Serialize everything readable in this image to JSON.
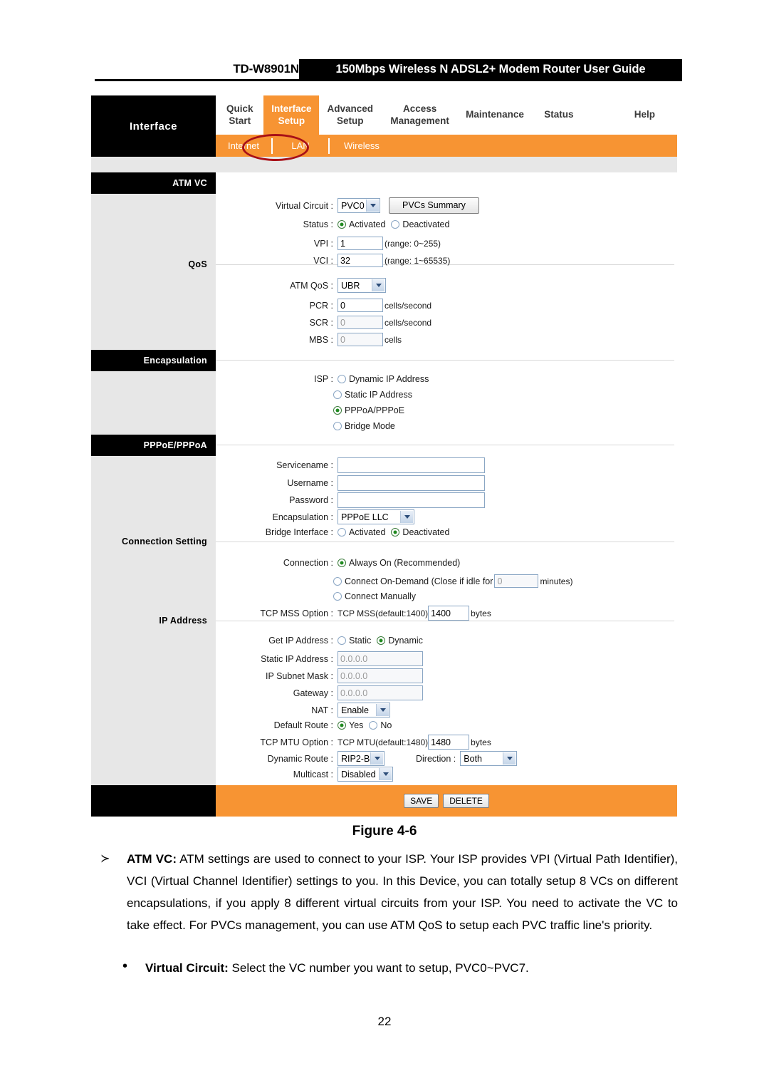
{
  "doc_header": {
    "model": "TD-W8901N",
    "title": "150Mbps Wireless N ADSL2+ Modem Router User Guide"
  },
  "router_ui": {
    "brand_label": "Interface",
    "tabs": [
      {
        "id": "quick-start",
        "line1": "Quick",
        "line2": "Start",
        "active": false
      },
      {
        "id": "interface-setup",
        "line1": "Interface",
        "line2": "Setup",
        "active": true
      },
      {
        "id": "advanced-setup",
        "line1": "Advanced",
        "line2": "Setup",
        "active": false
      },
      {
        "id": "access-management",
        "line1": "Access",
        "line2": "Management",
        "active": false
      },
      {
        "id": "maintenance",
        "line1": "Maintenance",
        "line2": "",
        "active": false
      },
      {
        "id": "status",
        "line1": "Status",
        "line2": "",
        "active": false
      },
      {
        "id": "help",
        "line1": "Help",
        "line2": "",
        "active": false
      }
    ],
    "subtabs": [
      {
        "id": "internet",
        "label": "Internet",
        "active": true
      },
      {
        "id": "lan",
        "label": "LAN",
        "active": false
      },
      {
        "id": "wireless",
        "label": "Wireless",
        "active": false
      }
    ],
    "section_headers": {
      "atm_vc": "ATM VC",
      "qos": "QoS",
      "encapsulation": "Encapsulation",
      "pppoe_pppoa": "PPPoE/PPPoA",
      "connection_setting": "Connection Setting",
      "ip_address": "IP Address"
    },
    "atm_vc": {
      "virtual_circuit_label": "Virtual Circuit :",
      "virtual_circuit_value": "PVC0",
      "pvcs_summary_button": "PVCs Summary",
      "status_label": "Status :",
      "status_activated": "Activated",
      "status_deactivated": "Deactivated",
      "status_selected": "Activated",
      "vpi_label": "VPI :",
      "vpi_value": "1",
      "vpi_hint": "(range: 0~255)",
      "vci_label": "VCI :",
      "vci_value": "32",
      "vci_hint": "(range: 1~65535)"
    },
    "qos": {
      "atm_qos_label": "ATM QoS :",
      "atm_qos_value": "UBR",
      "pcr_label": "PCR :",
      "pcr_value": "0",
      "pcr_unit": "cells/second",
      "scr_label": "SCR :",
      "scr_value": "0",
      "scr_unit": "cells/second",
      "mbs_label": "MBS :",
      "mbs_value": "0",
      "mbs_unit": "cells"
    },
    "encapsulation": {
      "isp_label": "ISP :",
      "options": [
        "Dynamic IP Address",
        "Static IP Address",
        "PPPoA/PPPoE",
        "Bridge Mode"
      ],
      "selected": "PPPoA/PPPoE"
    },
    "pppoe_pppoa": {
      "servicename_label": "Servicename :",
      "servicename_value": "",
      "username_label": "Username :",
      "username_value": "",
      "password_label": "Password :",
      "password_value": "",
      "encapsulation_label": "Encapsulation :",
      "encapsulation_value": "PPPoE LLC",
      "bridge_interface_label": "Bridge Interface :",
      "bridge_activated": "Activated",
      "bridge_deactivated": "Deactivated",
      "bridge_selected": "Deactivated"
    },
    "connection_setting": {
      "connection_label": "Connection :",
      "always_on": "Always On (Recommended)",
      "on_demand_pre": "Connect On-Demand (Close if idle for",
      "on_demand_value": "0",
      "on_demand_post": "minutes)",
      "connect_manually": "Connect Manually",
      "connection_selected": "Always On (Recommended)",
      "tcp_mss_option_label": "TCP MSS Option :",
      "tcp_mss_prefix": "TCP MSS(default:1400)",
      "tcp_mss_value": "1400",
      "tcp_mss_unit": "bytes"
    },
    "ip_address": {
      "get_ip_label": "Get IP Address :",
      "get_ip_static": "Static",
      "get_ip_dynamic": "Dynamic",
      "get_ip_selected": "Dynamic",
      "static_ip_label": "Static IP Address :",
      "static_ip_value": "0.0.0.0",
      "subnet_label": "IP Subnet Mask :",
      "subnet_value": "0.0.0.0",
      "gateway_label": "Gateway :",
      "gateway_value": "0.0.0.0",
      "nat_label": "NAT :",
      "nat_value": "Enable",
      "default_route_label": "Default Route :",
      "default_route_yes": "Yes",
      "default_route_no": "No",
      "default_route_selected": "Yes",
      "tcp_mtu_option_label": "TCP MTU Option :",
      "tcp_mtu_prefix": "TCP MTU(default:1480)",
      "tcp_mtu_value": "1480",
      "tcp_mtu_unit": "bytes",
      "dynamic_route_label": "Dynamic Route :",
      "dynamic_route_value": "RIP2-B",
      "direction_label": "Direction :",
      "direction_value": "Both",
      "multicast_label": "Multicast :",
      "multicast_value": "Disabled"
    },
    "actions": {
      "save": "SAVE",
      "delete": "DELETE"
    },
    "annotation": {
      "shape": "red-ellipse",
      "target": "Internet"
    }
  },
  "figure_caption": "Figure 4-6",
  "prose": {
    "item1_marker": "≻",
    "item1_bold": "ATM VC:",
    "item1_text": " ATM settings are used to connect to your ISP. Your ISP provides VPI (Virtual Path Identifier), VCI (Virtual Channel Identifier) settings to you. In this Device, you can totally setup 8 VCs on different encapsulations, if you apply 8 different virtual circuits from your ISP. You need to activate the VC to take effect. For PVCs management, you can use ATM QoS to setup each PVC traffic line's priority.",
    "item2_marker": "•",
    "item2_bold": "Virtual Circuit:",
    "item2_text": " Select the VC number you want to setup, PVC0~PVC7."
  },
  "page_number": "22"
}
